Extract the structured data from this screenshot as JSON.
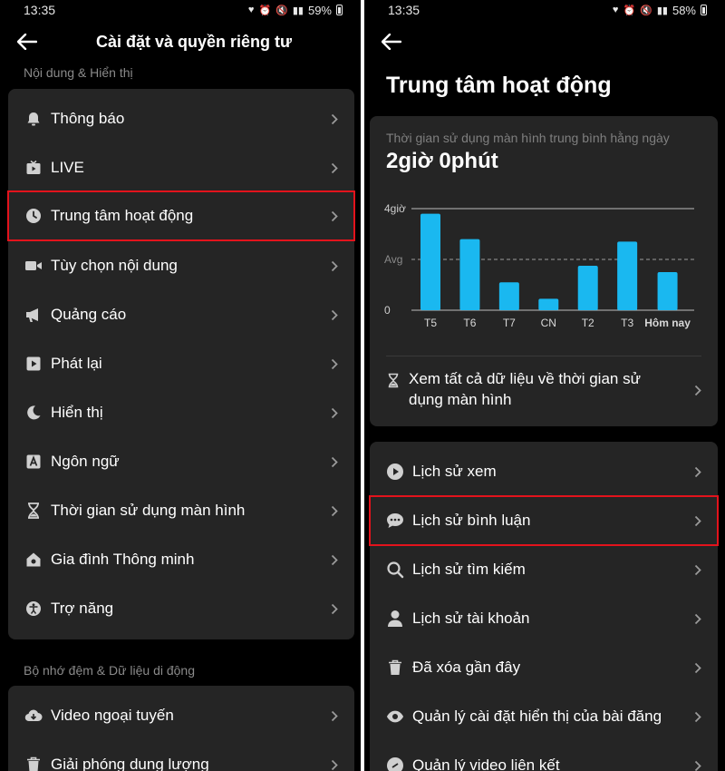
{
  "left": {
    "status": {
      "time": "13:35",
      "battery": "59%"
    },
    "header": {
      "title": "Cài đặt và quyền riêng tư"
    },
    "section1": "Nội dung & Hiển thị",
    "items": [
      {
        "label": "Thông báo",
        "icon": "bell-icon"
      },
      {
        "label": "LIVE",
        "icon": "live-icon"
      },
      {
        "label": "Trung tâm hoạt động",
        "icon": "clock-icon"
      },
      {
        "label": "Tùy chọn nội dung",
        "icon": "video-camera-icon"
      },
      {
        "label": "Quảng cáo",
        "icon": "megaphone-icon"
      },
      {
        "label": "Phát lại",
        "icon": "play-square-icon"
      },
      {
        "label": "Hiển thị",
        "icon": "moon-icon"
      },
      {
        "label": "Ngôn ngữ",
        "icon": "language-icon"
      },
      {
        "label": "Thời gian sử dụng màn hình",
        "icon": "hourglass-icon"
      },
      {
        "label": "Gia đình Thông minh",
        "icon": "house-icon"
      },
      {
        "label": "Trợ năng",
        "icon": "accessibility-icon"
      }
    ],
    "section2": "Bộ nhớ đệm & Dữ liệu di động",
    "items2": [
      {
        "label": "Video ngoại tuyến",
        "icon": "cloud-download-icon"
      },
      {
        "label": "Giải phóng dung lượng",
        "icon": "trash-icon"
      }
    ]
  },
  "right": {
    "status": {
      "time": "13:35",
      "battery": "58%"
    },
    "title": "Trung tâm hoạt động",
    "stat_caption": "Thời gian sử dụng màn hình trung bình hằng ngày",
    "stat_value": "2giờ 0phút",
    "view_all": "Xem tất cả dữ liệu về thời gian sử dụng màn hình",
    "items": [
      {
        "label": "Lịch sử xem",
        "icon": "play-circle-icon"
      },
      {
        "label": "Lịch sử bình luận",
        "icon": "comment-icon"
      },
      {
        "label": "Lịch sử tìm kiếm",
        "icon": "search-icon"
      },
      {
        "label": "Lịch sử tài khoản",
        "icon": "person-icon"
      },
      {
        "label": "Đã xóa gần đây",
        "icon": "trash-icon"
      },
      {
        "label": "Quản lý cài đặt hiển thị của bài đăng",
        "icon": "eye-icon"
      },
      {
        "label": "Quản lý video liên kết",
        "icon": "link-icon"
      }
    ]
  },
  "chart_data": {
    "type": "bar",
    "categories": [
      "T5",
      "T6",
      "T7",
      "CN",
      "T2",
      "T3",
      "Hôm nay"
    ],
    "values": [
      3.8,
      2.8,
      1.1,
      0.45,
      1.75,
      2.7,
      1.5
    ],
    "unit": "giờ",
    "ylim": [
      0,
      4
    ],
    "y_ticks": [
      {
        "value": 4,
        "label": "4giờ"
      },
      {
        "value": 2,
        "label": "Avg"
      },
      {
        "value": 0,
        "label": "0"
      }
    ],
    "avg": 2,
    "bar_color": "#1ab8f0",
    "grid": true
  },
  "colors": {
    "background": "#000000",
    "card": "#252525",
    "highlight": "#e3131c",
    "accent": "#1ab8f0"
  }
}
